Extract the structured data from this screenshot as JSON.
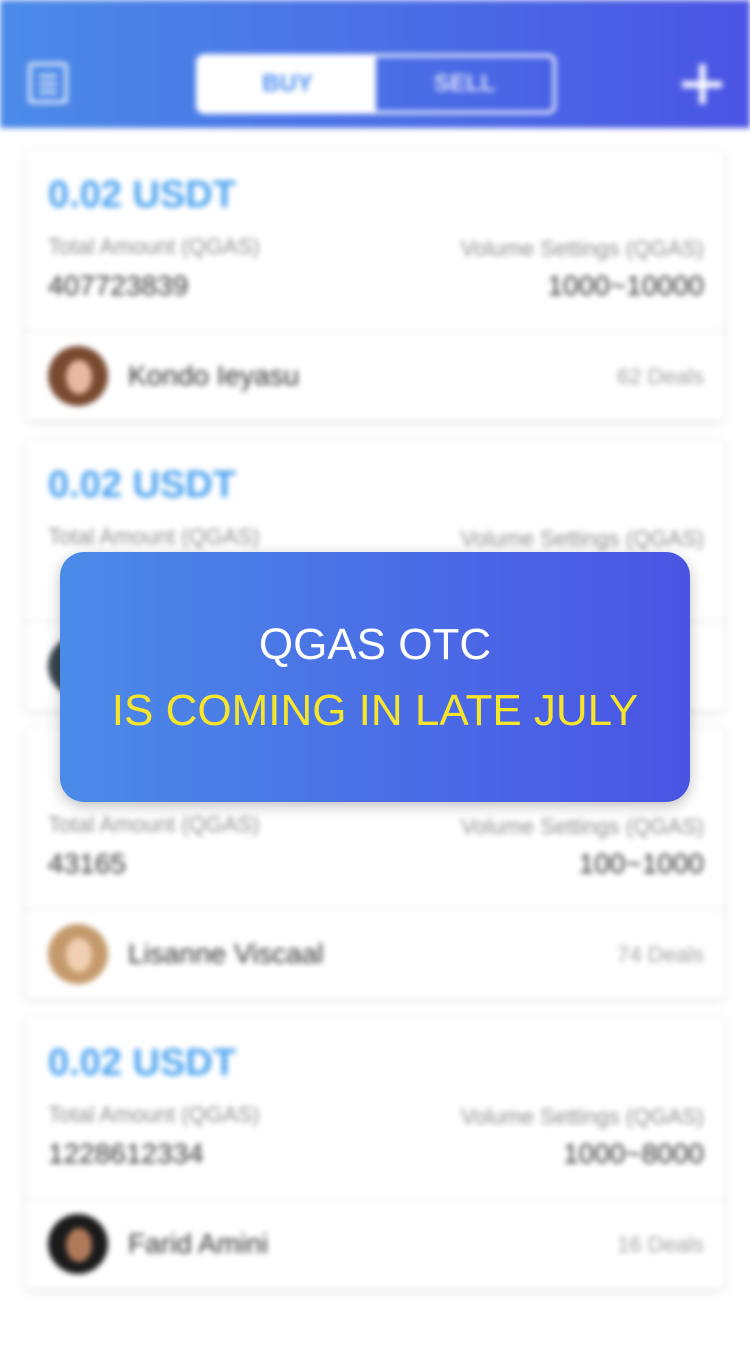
{
  "header": {
    "tabs": [
      {
        "label": "BUY",
        "active": true
      },
      {
        "label": "SELL",
        "active": false
      }
    ]
  },
  "listings": [
    {
      "price": "0.02 USDT",
      "total_label": "Total Amount (QGAS)",
      "total_value": "407723839",
      "volume_label": "Volume Settings (QGAS)",
      "volume_value": "1000~10000",
      "user_name": "Kondo Ieyasu",
      "deals": "62 Deals",
      "avatar_hair": "#7a4a30",
      "avatar_face": "#e6b9a0"
    },
    {
      "price": "0.02 USDT",
      "total_label": "Total Amount (QGAS)",
      "total_value": "",
      "volume_label": "Volume Settings (QGAS)",
      "volume_value": "",
      "user_name": "",
      "deals": "",
      "avatar_hair": "#3a4650",
      "avatar_face": "#c9a48c"
    },
    {
      "price": "",
      "total_label": "Total Amount (QGAS)",
      "total_value": "43165",
      "volume_label": "Volume Settings (QGAS)",
      "volume_value": "100~1000",
      "user_name": "Lisanne Viscaal",
      "deals": "74 Deals",
      "avatar_hair": "#c49a6c",
      "avatar_face": "#f0cfb2"
    },
    {
      "price": "0.02 USDT",
      "total_label": "Total Amount (QGAS)",
      "total_value": "1228612334",
      "volume_label": "Volume Settings (QGAS)",
      "volume_value": "1000~8000",
      "user_name": "Farid Amini",
      "deals": "16 Deals",
      "avatar_hair": "#1a1a1a",
      "avatar_face": "#b07a5a"
    }
  ],
  "overlay": {
    "title": "QGAS OTC",
    "subtitle": "IS COMING IN LATE JULY"
  },
  "colors": {
    "header_gradient_start": "#4b8be8",
    "header_gradient_end": "#4a54e4",
    "price": "#4aa2f0",
    "highlight_text": "#f7e52a"
  },
  "icons": {
    "menu": "document-list-icon",
    "add": "plus-icon"
  }
}
